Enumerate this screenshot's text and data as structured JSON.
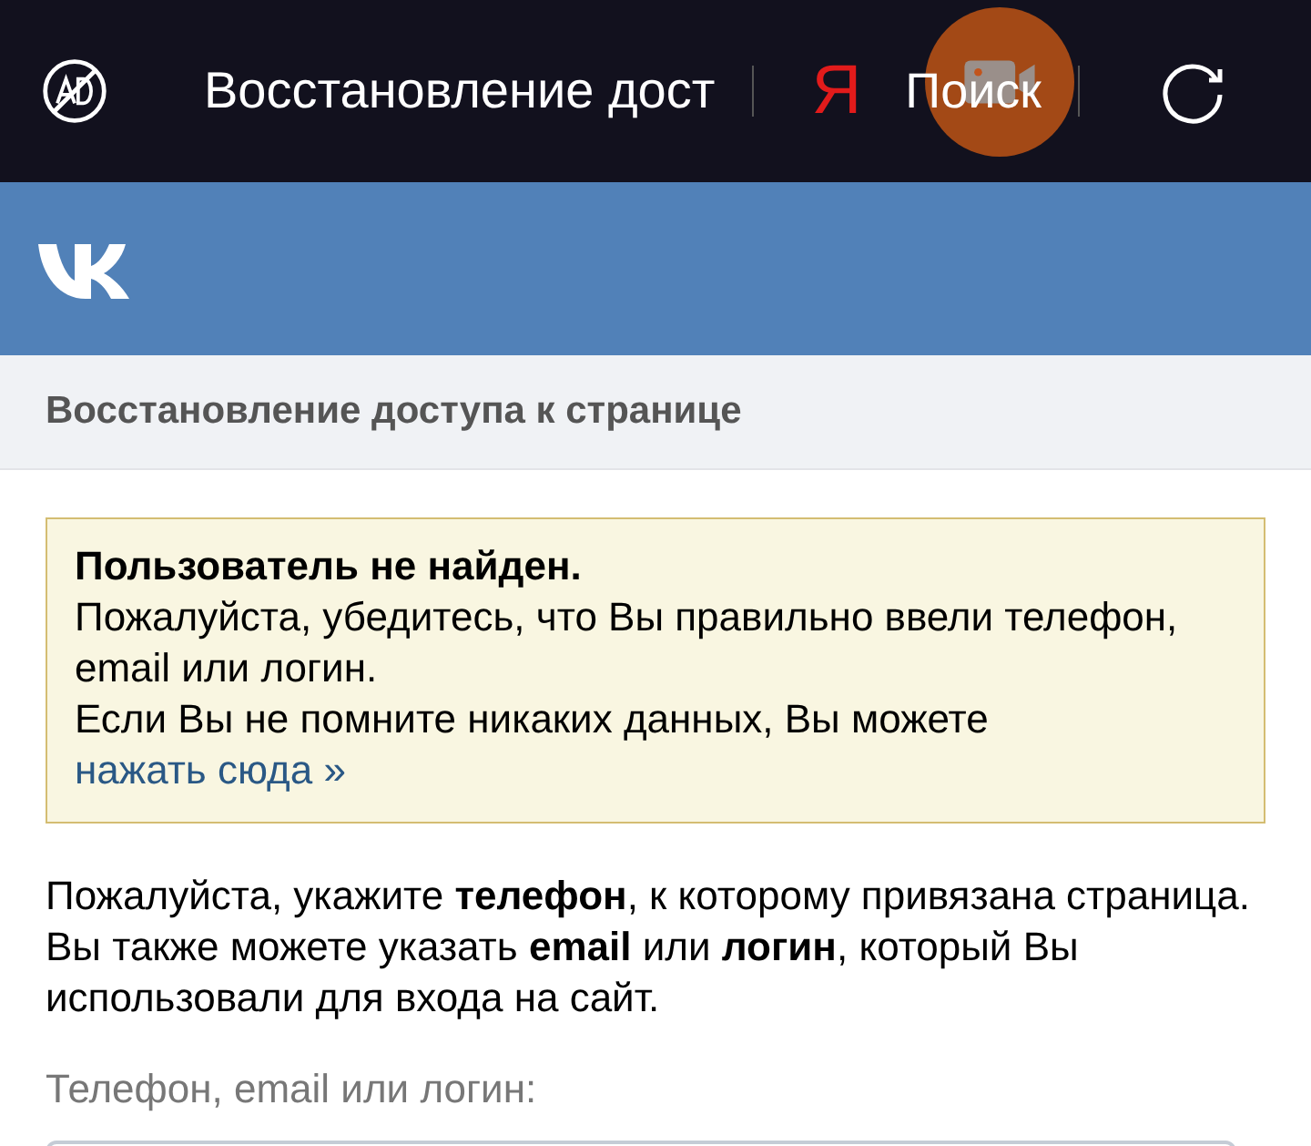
{
  "browser_bar": {
    "title": "Восстановление дост",
    "search_logo": "Я",
    "search_label": "Поиск"
  },
  "page_header": {
    "title": "Восстановление доступа к странице"
  },
  "notice": {
    "title": "Пользователь не найден.",
    "text": "Пожалуйста, убедитесь, что Вы правильно ввели телефон, email или логин.",
    "text2": "Если Вы не помните никаких данных, Вы можете",
    "link": "нажать сюда »"
  },
  "instructions": "Пожалуйста, укажите **телефон**, к которому привязана страница. Вы также можете указать **email** или **логин**, который Вы использовали для входа на сайт.",
  "field": {
    "label": "Телефон, email или логин:"
  }
}
